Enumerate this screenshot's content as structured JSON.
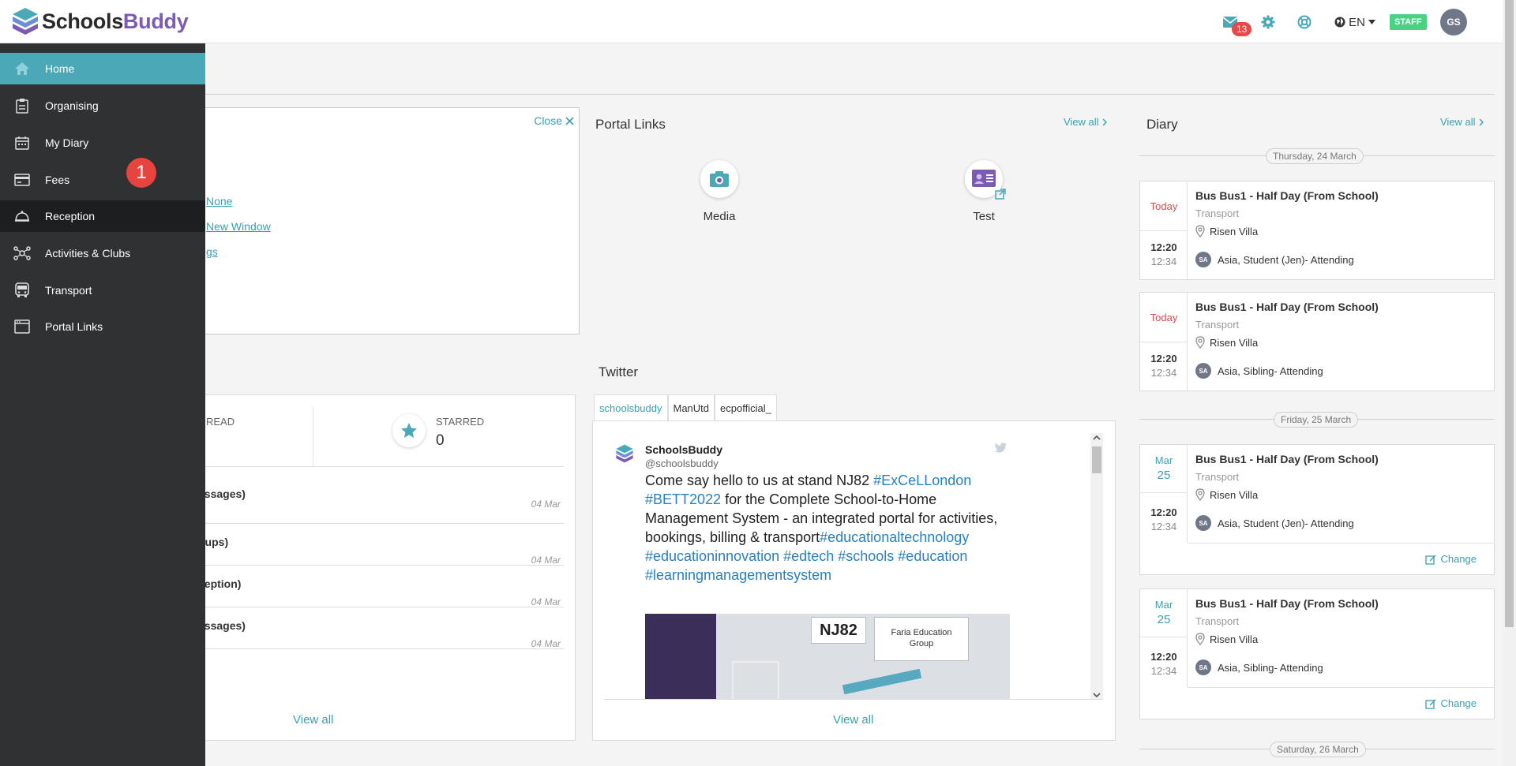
{
  "app": {
    "brand_a": "Schools",
    "brand_b": "Buddy"
  },
  "header": {
    "mail_count": "13",
    "language": "EN",
    "role_badge": "STAFF",
    "user_initials": "GS"
  },
  "sidebar": {
    "items": [
      {
        "label": "Home",
        "icon": "home-icon"
      },
      {
        "label": "Organising",
        "icon": "clipboard-icon"
      },
      {
        "label": "My Diary",
        "icon": "calendar-icon"
      },
      {
        "label": "Fees",
        "icon": "credit-card-icon"
      },
      {
        "label": "Reception",
        "icon": "bell-icon"
      },
      {
        "label": "Activities & Clubs",
        "icon": "network-icon"
      },
      {
        "label": "Transport",
        "icon": "bus-icon"
      },
      {
        "label": "Portal Links",
        "icon": "window-icon"
      }
    ],
    "step_marker": "1"
  },
  "settings_panel": {
    "close": "Close",
    "links": [
      "None",
      "New Window",
      "gs"
    ]
  },
  "portal_links": {
    "title": "Portal Links",
    "view_all": "View all",
    "items": [
      {
        "label": "Media",
        "icon": "camera-icon"
      },
      {
        "label": "Test",
        "icon": "id-card-icon"
      }
    ]
  },
  "messages": {
    "read_label": "READ",
    "starred_label": "STARRED",
    "starred_value": "0",
    "rows": [
      {
        "title": "essages)",
        "date": "04 Mar"
      },
      {
        "title": "oups)",
        "date": "04 Mar"
      },
      {
        "title": "ception)",
        "date": "04 Mar"
      },
      {
        "title": "essages)",
        "date": "04 Mar"
      }
    ],
    "view_all": "View all"
  },
  "twitter": {
    "title": "Twitter",
    "tabs": [
      "schoolsbuddy",
      "ManUtd",
      "ecpofficial_"
    ],
    "tweet": {
      "author": "SchoolsBuddy",
      "handle": "@schoolsbuddy",
      "text_1": "Come say hello to us at stand NJ82 ",
      "tag_1": "#ExCeLLondon",
      "tag_2": "#BETT2022",
      "text_2": " for the Complete School-to-Home Management System - an integrated portal for activities, bookings, billing & transport",
      "tag_3": "#educationaltechnology",
      "tag_4": "#educationinnovation",
      "tag_5": "#edtech",
      "tag_6": "#schools",
      "tag_7": "#education",
      "tag_8": "#learningmanagementsystem",
      "img_stand": "NJ82",
      "img_sign_1": "Faria Education",
      "img_sign_2": "Group"
    },
    "view_all": "View all"
  },
  "diary": {
    "title": "Diary",
    "view_all": "View all",
    "dates": [
      "Thursday, 24 March",
      "Friday, 25 March",
      "Saturday, 26 March"
    ],
    "events": [
      {
        "day": "Today",
        "title": "Bus Bus1 - Half Day (From School)",
        "category": "Transport",
        "location": "Risen Villa",
        "attendee_initials": "SA",
        "attendee": "Asia, Student (Jen)- Attending",
        "start": "12:20",
        "end": "12:34"
      },
      {
        "day": "Today",
        "title": "Bus Bus1 - Half Day (From School)",
        "category": "Transport",
        "location": "Risen Villa",
        "attendee_initials": "SA",
        "attendee": "Asia, Sibling- Attending",
        "start": "12:20",
        "end": "12:34"
      },
      {
        "month": "Mar",
        "date": "25",
        "title": "Bus Bus1 - Half Day (From School)",
        "category": "Transport",
        "location": "Risen Villa",
        "attendee_initials": "SA",
        "attendee": "Asia, Student (Jen)- Attending",
        "start": "12:20",
        "end": "12:34",
        "change": "Change"
      },
      {
        "month": "Mar",
        "date": "25",
        "title": "Bus Bus1 - Half Day (From School)",
        "category": "Transport",
        "location": "Risen Villa",
        "attendee_initials": "SA",
        "attendee": "Asia, Sibling- Attending",
        "start": "12:20",
        "end": "12:34",
        "change": "Change"
      }
    ]
  },
  "colors": {
    "accent": "#4aa8b7",
    "sidebar": "#303132",
    "alert": "#e74440",
    "staff": "#4cd083"
  }
}
